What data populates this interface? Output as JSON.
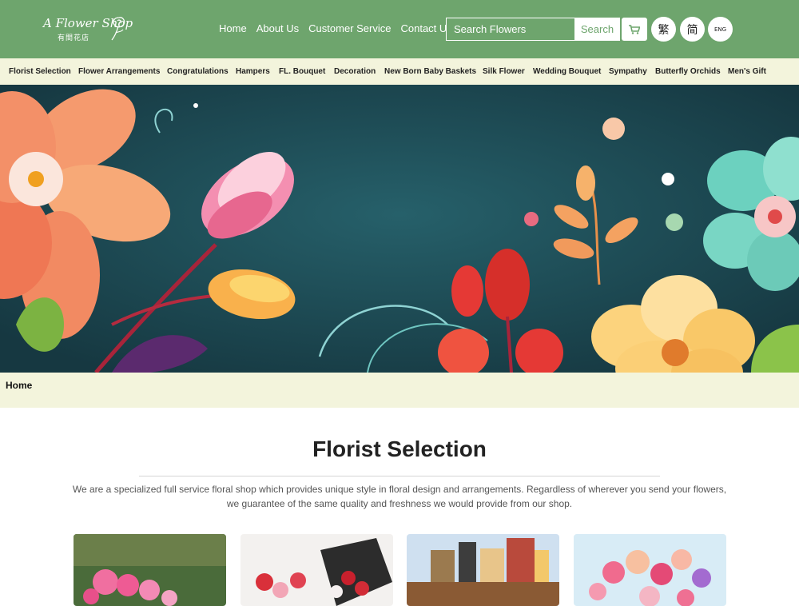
{
  "brand": {
    "script": "A Flower Shop",
    "chinese": "有間花店"
  },
  "topnav": [
    "Home",
    "About Us",
    "Customer Service",
    "Contact Us"
  ],
  "search": {
    "placeholder": "Search Flowers",
    "button": "Search"
  },
  "languages": [
    "繁",
    "简",
    "ENG"
  ],
  "categories": [
    "Florist Selection",
    "Flower Arrangements",
    "Congratulations",
    "Hampers",
    "FL. Bouquet",
    "Decoration",
    "New Born Baby Baskets",
    "Silk Flower",
    "Wedding Bouquet",
    "Sympathy",
    "Butterfly Orchids",
    "Men's Gift"
  ],
  "breadcrumb": "Home",
  "section": {
    "title": "Florist Selection",
    "intro": "We are a specialized full service floral shop which provides unique style in floral design and arrangements. Regardless of wherever you send your flowers, we guarantee of the same quality and freshness we would provide from our shop."
  },
  "colors": {
    "header": "#6ea56d",
    "nav_bg": "#f3f4dc",
    "banner_bg": "#1e4a55"
  },
  "icons": {
    "cart": "cart-icon",
    "logo": "rose-icon"
  }
}
